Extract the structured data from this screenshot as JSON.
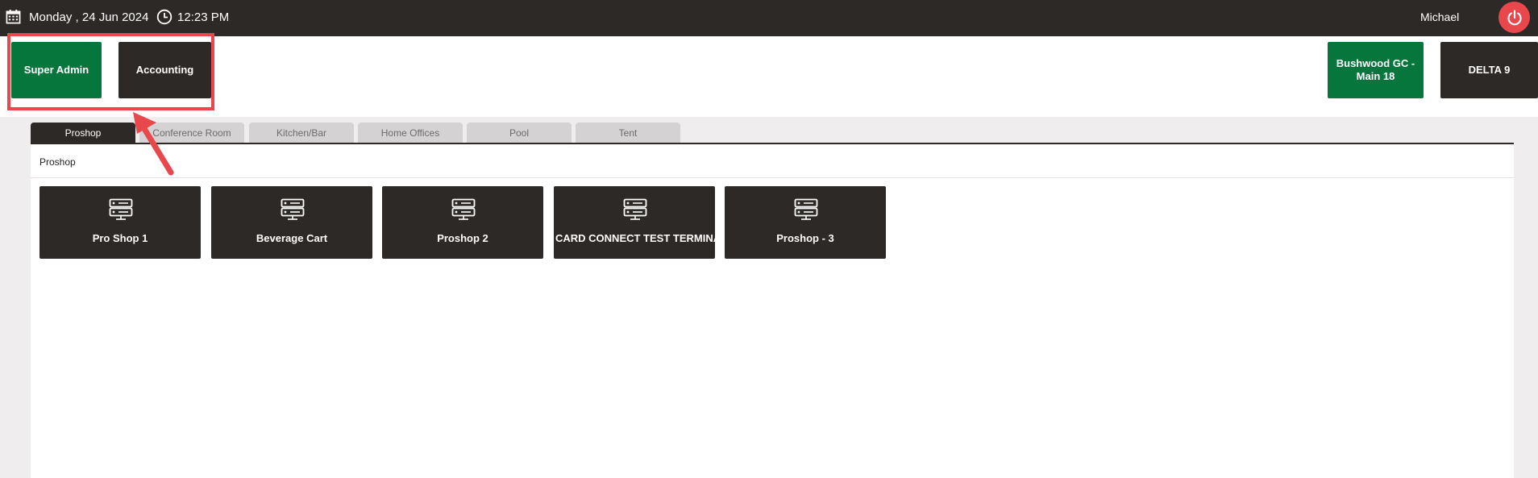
{
  "topbar": {
    "date": "Monday ,  24 Jun 2024",
    "time": "12:23 PM",
    "user": "Michael",
    "icons": {
      "calendar": "calendar-icon",
      "clock": "clock-icon",
      "power": "power-icon"
    }
  },
  "roles": {
    "super_admin": "Super Admin",
    "accounting": "Accounting"
  },
  "locations": {
    "course": "Bushwood GC - Main 18",
    "delta": "DELTA 9"
  },
  "tabs": [
    {
      "label": "Proshop",
      "active": true
    },
    {
      "label": "Conference Room",
      "active": false
    },
    {
      "label": "Kitchen/Bar",
      "active": false
    },
    {
      "label": "Home Offices",
      "active": false
    },
    {
      "label": "Pool",
      "active": false
    },
    {
      "label": "Tent",
      "active": false
    }
  ],
  "panel": {
    "breadcrumb": "Proshop",
    "terminals": [
      {
        "label": "Pro Shop 1",
        "icon": "server-icon"
      },
      {
        "label": "Beverage Cart",
        "icon": "server-icon"
      },
      {
        "label": "Proshop 2",
        "icon": "server-icon"
      },
      {
        "label": "CARD CONNECT TEST TERMINAL",
        "icon": "server-icon"
      },
      {
        "label": "Proshop - 3",
        "icon": "server-icon"
      }
    ]
  },
  "colors": {
    "dark": "#2d2926",
    "green": "#06763d",
    "highlight": "#e8474c",
    "background": "#efedee"
  }
}
